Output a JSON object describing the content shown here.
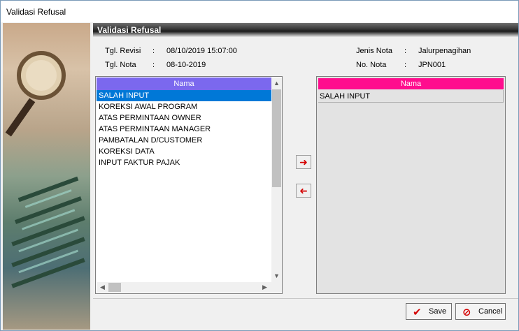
{
  "window": {
    "title": "Validasi Refusal"
  },
  "header": {
    "title": "Validasi Refusal"
  },
  "info": {
    "tgl_revisi": {
      "label": "Tgl. Revisi",
      "sep": ":",
      "value": "08/10/2019 15:07:00"
    },
    "tgl_nota": {
      "label": "Tgl. Nota",
      "sep": ":",
      "value": "08-10-2019"
    },
    "jenis_nota": {
      "label": "Jenis Nota",
      "sep": ":",
      "value": "Jalurpenagihan"
    },
    "no_nota": {
      "label": "No. Nota",
      "sep": ":",
      "value": "JPN001"
    }
  },
  "left_list": {
    "column": "Nama",
    "items": [
      "SALAH INPUT",
      "KOREKSI AWAL PROGRAM",
      "ATAS PERMINTAAN OWNER",
      "ATAS PERMINTAAN MANAGER",
      "PAMBATALAN D/CUSTOMER",
      "KOREKSI DATA",
      "INPUT FAKTUR PAJAK"
    ],
    "selected_index": 0
  },
  "right_list": {
    "column": "Nama",
    "items": [
      "SALAH INPUT"
    ]
  },
  "buttons": {
    "save": "Save",
    "cancel": "Cancel"
  },
  "icons": {
    "move_right": "arrow-right-icon",
    "move_left": "arrow-left-icon",
    "save": "check-icon",
    "cancel": "cancel-icon"
  },
  "colors": {
    "left_header": "#7b68ee",
    "right_header": "#ff0d8e",
    "selection": "#0078d7",
    "arrow": "#d40000"
  }
}
